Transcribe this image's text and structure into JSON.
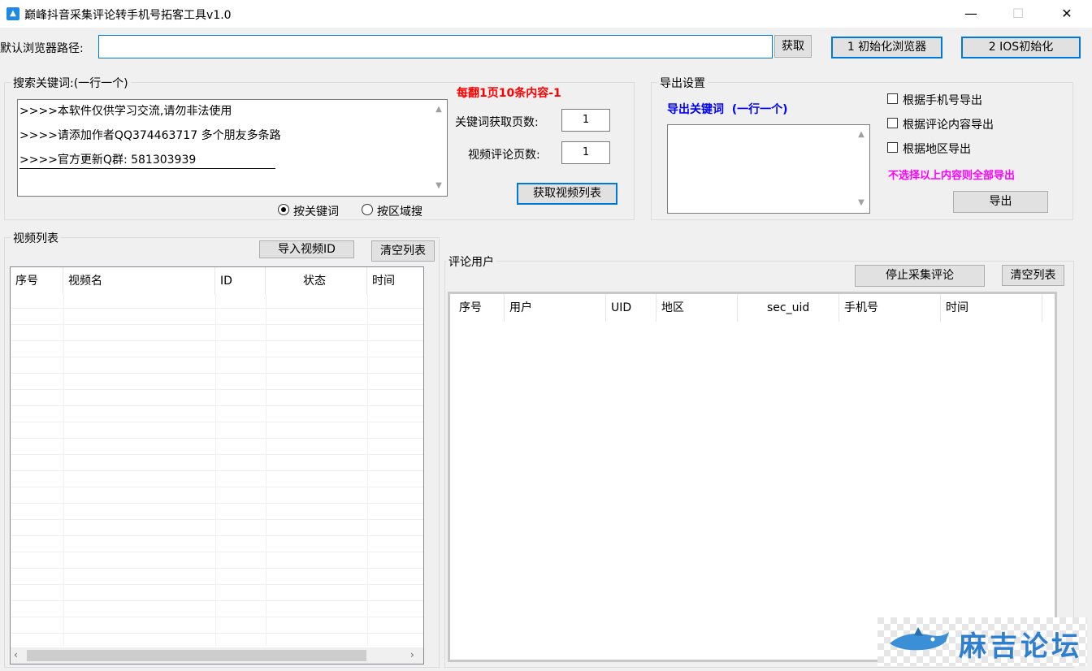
{
  "window": {
    "title": "巅峰抖音采集评论转手机号拓客工具v1.0",
    "minimize": "—",
    "maximize": "☐",
    "close": "✕"
  },
  "browser": {
    "path_label": "默认浏览器路径:",
    "path_value": "",
    "get_button": "获取",
    "init_browser_button": "1 初始化浏览器",
    "ios_init_button": "2 IOS初始化"
  },
  "search": {
    "group_title": "搜索关键词:(一行一个)",
    "lines": [
      ">>>>本软件仅供学习交流,请勿非法使用",
      ">>>>请添加作者QQ374463717 多个朋友多条路",
      ">>>>官方更新Q群: 581303939"
    ],
    "notice": "每翻1页10条内容-1",
    "keyword_pages_label": "关键词获取页数:",
    "keyword_pages_value": "1",
    "comment_pages_label": "视频评论页数:",
    "comment_pages_value": "1",
    "get_video_list_button": "获取视频列表",
    "radio_keyword": "按关键词",
    "radio_region": "按区域搜"
  },
  "export": {
    "group_title": "导出设置",
    "keyword_label": "导出关键词  (一行一个)",
    "by_phone": "根据手机号导出",
    "by_comment": "根据评论内容导出",
    "by_region": "根据地区导出",
    "hint": "不选择以上内容则全部导出",
    "export_button": "导出"
  },
  "videos": {
    "group_title": "视频列表",
    "import_button": "导入视频ID",
    "clear_button": "清空列表",
    "columns": [
      "序号",
      "视频名",
      "ID",
      "状态",
      "时间"
    ]
  },
  "comments": {
    "group_title": "评论用户",
    "stop_button": "停止采集评论",
    "clear_button": "清空列表",
    "columns": [
      "序号",
      "用户",
      "UID",
      "地区",
      "sec_uid",
      "手机号",
      "时间"
    ]
  },
  "watermark": {
    "text": "麻吉论坛"
  }
}
